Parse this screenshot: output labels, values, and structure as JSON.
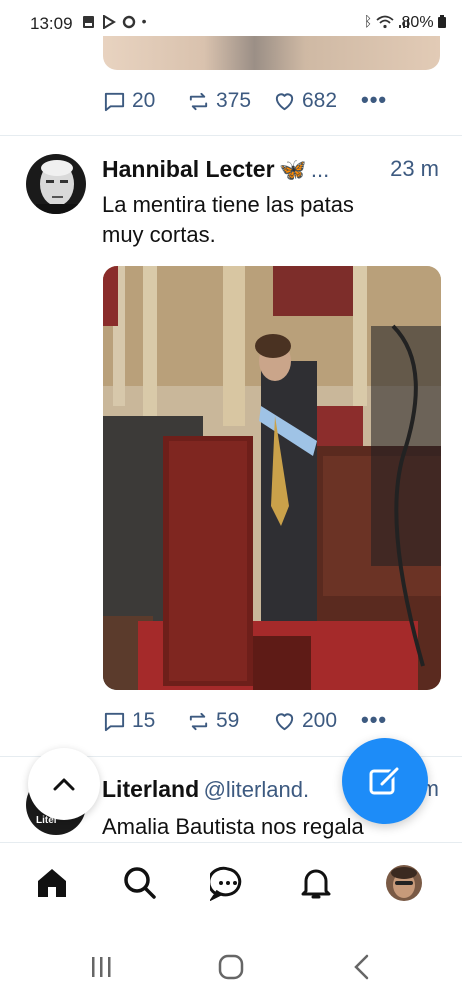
{
  "status_bar": {
    "time": "13:09",
    "notification_icons": [
      "pdf-icon",
      "play-icon",
      "sync-icon",
      "dot"
    ],
    "battery": "80%",
    "system_icons": [
      "bluetooth-icon",
      "wifi-icon",
      "signal-icon"
    ]
  },
  "previous_post": {
    "replies": "20",
    "reposts": "375",
    "likes": "682"
  },
  "post": {
    "author": "Hannibal Lecter",
    "emoji": "🦋",
    "ellipsis": "...",
    "time": "23 m",
    "text_line1": "La mentira tiene las patas",
    "text_line2": "muy cortas.",
    "replies": "15",
    "reposts": "59",
    "likes": "200"
  },
  "next_post": {
    "author": "Literland",
    "handle": "@literland.",
    "time_partial": "m",
    "text": "Amalia Bautista nos regala",
    "avatar_text": "Liter"
  },
  "more_label": "•••",
  "nav": [
    "home-icon",
    "search-icon",
    "chat-icon",
    "bell-icon",
    "profile-avatar"
  ],
  "colors": {
    "accent": "#1d8cf8",
    "action": "#3d5a80",
    "text": "#0f1419"
  }
}
